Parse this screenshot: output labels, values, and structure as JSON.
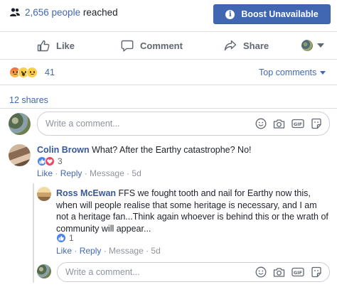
{
  "reach": {
    "count": "2,656 people",
    "suffix": " reached"
  },
  "boost": {
    "label": "Boost Unavailable",
    "info_glyph": "i"
  },
  "actions": {
    "like": "Like",
    "comment": "Comment",
    "share": "Share"
  },
  "reactions": {
    "count": "41",
    "top_comments": "Top comments",
    "icons": [
      "angry-face-icon",
      "wow-face-icon",
      "sad-face-icon"
    ]
  },
  "shares": "12 shares",
  "composer": {
    "placeholder": "Write a comment..."
  },
  "comments": [
    {
      "name": "Colin Brown",
      "text": " What? After the Earthy catastrophe? No!",
      "reaction_count": "3",
      "actions": {
        "like": "Like",
        "reply": "Reply",
        "message": "Message",
        "time": "5d"
      }
    }
  ],
  "replies": [
    {
      "name": "Ross McEwan",
      "text": " FFS we fought tooth and nail for Earthy now this, when will people realise that some heritage is necessary, and I am not a heritage fan...Think again whoever is behind this or the wrath of community will appear...",
      "reaction_count": "1",
      "actions": {
        "like": "Like",
        "reply": "Reply",
        "message": "Message",
        "time": "5d"
      }
    }
  ],
  "reply_composer": {
    "placeholder": "Write a comment..."
  },
  "separator": " · ",
  "colors": {
    "accent": "#4267b2",
    "link": "#385898",
    "muted": "#90949c",
    "border": "#dadde1",
    "love": "#f0435c"
  }
}
